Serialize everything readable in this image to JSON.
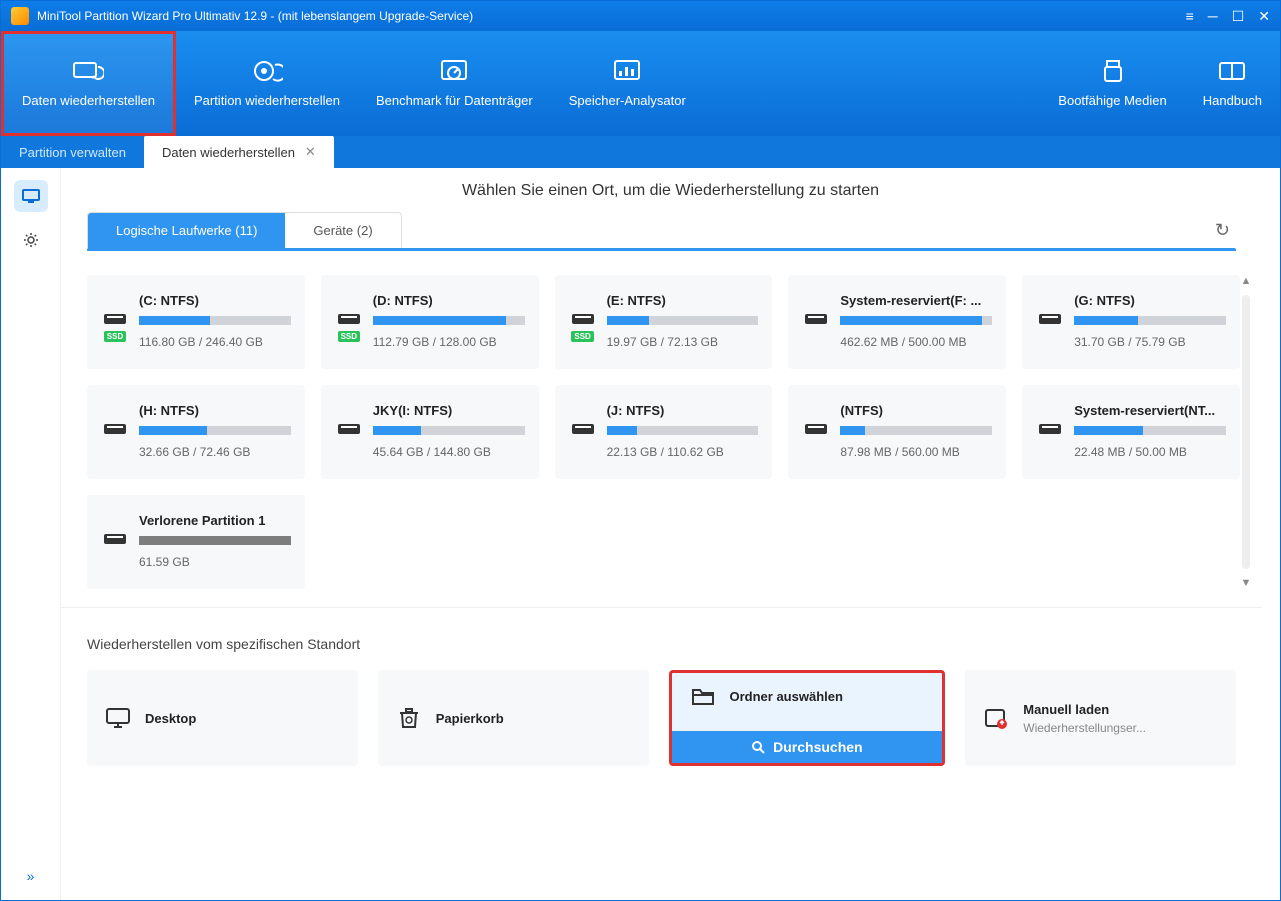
{
  "titlebar": {
    "title": "MiniTool Partition Wizard Pro Ultimativ 12.9 - (mit lebenslangem Upgrade-Service)"
  },
  "toolbar": {
    "data_recover": "Daten wiederherstellen",
    "partition_recover": "Partition wiederherstellen",
    "benchmark": "Benchmark für Datenträger",
    "analyzer": "Speicher-Analysator",
    "bootmedia": "Bootfähige Medien",
    "handbook": "Handbuch"
  },
  "tabs": {
    "manage": "Partition verwalten",
    "recover": "Daten wiederherstellen"
  },
  "main": {
    "header": "Wählen Sie einen Ort, um die Wiederherstellung zu starten",
    "innerTabs": {
      "logical": "Logische Laufwerke (11)",
      "devices": "Geräte (2)"
    }
  },
  "drives": [
    {
      "name": "(C: NTFS)",
      "size": "116.80 GB / 246.40 GB",
      "pct": 47,
      "ssd": true
    },
    {
      "name": "(D: NTFS)",
      "size": "112.79 GB / 128.00 GB",
      "pct": 88,
      "ssd": true
    },
    {
      "name": "(E: NTFS)",
      "size": "19.97 GB / 72.13 GB",
      "pct": 28,
      "ssd": true
    },
    {
      "name": "System-reserviert(F: ...",
      "size": "462.62 MB / 500.00 MB",
      "pct": 93,
      "ssd": false
    },
    {
      "name": "(G: NTFS)",
      "size": "31.70 GB / 75.79 GB",
      "pct": 42,
      "ssd": false
    },
    {
      "name": "(H: NTFS)",
      "size": "32.66 GB / 72.46 GB",
      "pct": 45,
      "ssd": false
    },
    {
      "name": "JKY(I: NTFS)",
      "size": "45.64 GB / 144.80 GB",
      "pct": 32,
      "ssd": false
    },
    {
      "name": "(J: NTFS)",
      "size": "22.13 GB / 110.62 GB",
      "pct": 20,
      "ssd": false
    },
    {
      "name": "(NTFS)",
      "size": "87.98 MB / 560.00 MB",
      "pct": 16,
      "ssd": false
    },
    {
      "name": "System-reserviert(NT...",
      "size": "22.48 MB / 50.00 MB",
      "pct": 45,
      "ssd": false
    },
    {
      "name": "Verlorene Partition 1",
      "size": "61.59 GB",
      "pct": 100,
      "ssd": false,
      "lost": true
    }
  ],
  "locations": {
    "title": "Wiederherstellen vom spezifischen Standort",
    "desktop": "Desktop",
    "trash": "Papierkorb",
    "folder": "Ordner auswählen",
    "browse": "Durchsuchen",
    "manual_t": "Manuell laden",
    "manual_s": "Wiederherstellungser..."
  },
  "ssd_label": "SSD"
}
